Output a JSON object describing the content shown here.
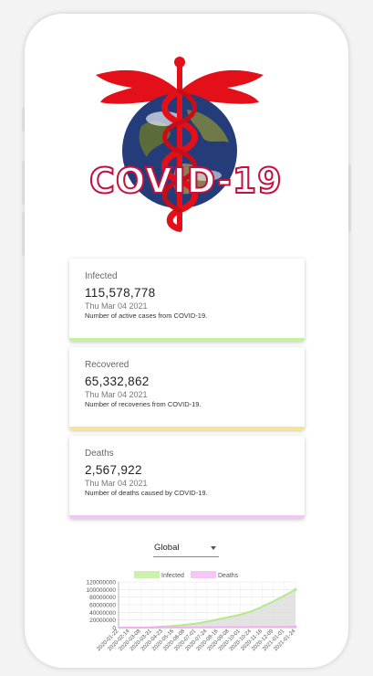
{
  "app": {
    "logo_text": "COVID-19",
    "logo_colors": {
      "wings": "#e3101a",
      "globe": "#243c7a",
      "text_outline": "#c4103d"
    }
  },
  "cards": [
    {
      "title": "Infected",
      "value": "115,578,778",
      "date": "Thu Mar 04 2021",
      "description": "Number of active cases from COVID-19.",
      "color": "#c4f29a"
    },
    {
      "title": "Recovered",
      "value": "65,332,862",
      "date": "Thu Mar 04 2021",
      "description": "Number of recoveries from COVID-19.",
      "color": "#f3e49a"
    },
    {
      "title": "Deaths",
      "value": "2,567,922",
      "date": "Thu Mar 04 2021",
      "description": "Number of deaths caused by COVID-19.",
      "color": "#f0c6f2"
    }
  ],
  "region_select": {
    "value": "Global"
  },
  "chart_data": {
    "type": "line",
    "legend": [
      "Infected",
      "Deaths"
    ],
    "legend_position": "top",
    "grid": true,
    "ylim": [
      0,
      120000000
    ],
    "yticks": [
      "120000000",
      "100000000",
      "80000000",
      "60000000",
      "40000000",
      "20000000",
      "0"
    ],
    "categories": [
      "2020-01-22",
      "2020-02-14",
      "2020-03-08",
      "2020-03-31",
      "2020-04-23",
      "2020-05-16",
      "2020-06-08",
      "2020-07-01",
      "2020-07-24",
      "2020-08-16",
      "2020-09-08",
      "2020-10-01",
      "2020-10-24",
      "2020-11-16",
      "2020-12-09",
      "2021-01-01",
      "2021-01-24"
    ],
    "series": [
      {
        "name": "Infected",
        "color": "#b6e98a",
        "fill": "#dcdcdc",
        "values": [
          500,
          70000,
          110000,
          860000,
          2700000,
          4600000,
          7100000,
          10600000,
          15700000,
          21600000,
          27600000,
          34000000,
          42600000,
          55000000,
          69000000,
          84000000,
          100000000
        ]
      },
      {
        "name": "Deaths",
        "color": "#f0b0f0",
        "fill": "#f5dcf5",
        "values": [
          17,
          1500,
          3800,
          43000,
          190000,
          310000,
          410000,
          515000,
          645000,
          775000,
          900000,
          1015000,
          1150000,
          1320000,
          1560000,
          1830000,
          2130000
        ]
      }
    ]
  }
}
